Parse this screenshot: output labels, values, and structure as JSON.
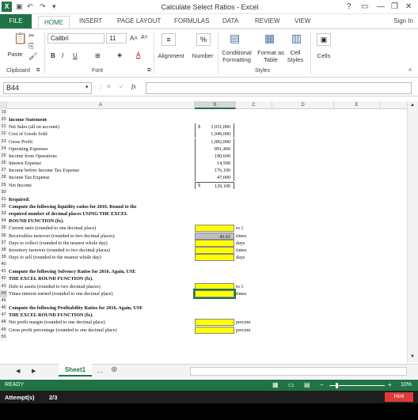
{
  "window": {
    "title": "Calculate Select Ratios - Excel",
    "help": "?",
    "minimize": "—",
    "close": "✕"
  },
  "ribbon_tabs": [
    "FILE",
    "HOME",
    "INSERT",
    "PAGE LAYOUT",
    "FORMULAS",
    "DATA",
    "REVIEW",
    "VIEW"
  ],
  "signin": "Sign In",
  "ribbon": {
    "font_name": "Calibri",
    "font_size": "11",
    "paste": "Paste",
    "alignment": "Alignment",
    "number": "Number",
    "cond_format": "Conditional Formatting",
    "format_table": "Format as Table",
    "cell_styles": "Cell Styles",
    "cells": "Cells",
    "groups": {
      "clipboard": "Clipboard",
      "font": "Font",
      "styles": "Styles"
    }
  },
  "formula": {
    "name_box": "B44",
    "fx": "fx"
  },
  "columns": [
    "A",
    "B",
    "C",
    "D",
    "E"
  ],
  "rows": [
    {
      "n": "19",
      "a": "",
      "b": "",
      "c": "",
      "bold": false
    },
    {
      "n": "20",
      "a": "Income Statement",
      "b": "",
      "c": "",
      "bold": true
    },
    {
      "n": "21",
      "a": "Net Sales (all on account)",
      "b": "3,031,000",
      "c": "",
      "dollar": "$"
    },
    {
      "n": "22",
      "a": "Cost of Goods Sold",
      "b": "1,949,000",
      "c": ""
    },
    {
      "n": "23",
      "a": "Gross Profit",
      "b": "1,082,000",
      "c": ""
    },
    {
      "n": "24",
      "a": "Operating Expenses",
      "b": "891,400",
      "c": ""
    },
    {
      "n": "25",
      "a": "Income from Operations",
      "b": "190,600",
      "c": ""
    },
    {
      "n": "26",
      "a": "Interest Expense",
      "b": "14,500",
      "c": ""
    },
    {
      "n": "27",
      "a": "Income before Income Tax Expense",
      "b": "176,100",
      "c": ""
    },
    {
      "n": "28",
      "a": "Income Tax Expense",
      "b": "47,000",
      "c": ""
    },
    {
      "n": "29",
      "a": "Net Income",
      "b": "129,100",
      "c": "",
      "dollar": "$"
    },
    {
      "n": "30",
      "a": "",
      "b": "",
      "c": ""
    },
    {
      "n": "31",
      "a": "Required:",
      "b": "",
      "c": "",
      "bold": true
    },
    {
      "n": "32",
      "a": "Compute the following liquidity ratios for 2016. Round to the",
      "b": "",
      "c": "",
      "bold": true
    },
    {
      "n": "33",
      "a": "required number of decimal places USING THE EXCEL",
      "b": "",
      "c": "",
      "bold": true
    },
    {
      "n": "34",
      "a": "ROUND FUNCTION (fx).",
      "b": "",
      "c": "",
      "bold": true
    },
    {
      "n": "35",
      "a": "   Current ratio (rounded to one decimal place)",
      "b": "",
      "c": "to 1",
      "cell": "yellow"
    },
    {
      "n": "36",
      "a": "   Receivables turnover (rounded to two decimal places)",
      "b": "43.61",
      "c": "times",
      "cell": "gray"
    },
    {
      "n": "37",
      "a": "   Days to collect (rounded to the nearest whole day)",
      "b": "",
      "c": "days",
      "cell": "yellow"
    },
    {
      "n": "38",
      "a": "   Inventory turnover (rounded to two decimal places)",
      "b": "",
      "c": "times",
      "cell": "yellow"
    },
    {
      "n": "39",
      "a": "   Days to sell (rounded to the nearest whole day)",
      "b": "",
      "c": "days",
      "cell": "yellow"
    },
    {
      "n": "40",
      "a": "",
      "b": "",
      "c": ""
    },
    {
      "n": "41",
      "a": "Compute the following Solvency Ratios for 2016. Again, USE",
      "b": "",
      "c": "",
      "bold": true
    },
    {
      "n": "42",
      "a": "THE EXCEL ROUND FUNCTION (fx).",
      "b": "",
      "c": "",
      "bold": true
    },
    {
      "n": "43",
      "a": "   Debt to assets (rounded to two decimal places)",
      "b": "",
      "c": "to 1",
      "cell": "yellow"
    },
    {
      "n": "44",
      "a": "   Times interest earned (rounded to one decimal place)",
      "b": "",
      "c": "times",
      "cell": "yellow"
    },
    {
      "n": "45",
      "a": "",
      "b": "",
      "c": ""
    },
    {
      "n": "46",
      "a": "Compute the following Profitability Ratios for 2016. Again, USE",
      "b": "",
      "c": "",
      "bold": true
    },
    {
      "n": "47",
      "a": "THE EXCEL ROUND FUNCTION (fx).",
      "b": "",
      "c": "",
      "bold": true
    },
    {
      "n": "48",
      "a": "   Net profit margin (rounded to one decimal place)",
      "b": "",
      "c": "percent",
      "cell": "yellow"
    },
    {
      "n": "49",
      "a": "   Gross profit percentage (rounded to one decimal place)",
      "b": "",
      "c": "percent",
      "cell": "yellow"
    },
    {
      "n": "50",
      "a": "",
      "b": "",
      "c": ""
    }
  ],
  "sheet_tab": "Sheet1",
  "status": {
    "ready": "READY",
    "zoom": "10%"
  },
  "attempts": {
    "label": "Attempt(s)",
    "value": "2/3",
    "hint": "Hint"
  },
  "colors": {
    "excel_green": "#217346",
    "yellow": "#ffff00",
    "hint_red": "#e03a3a"
  }
}
